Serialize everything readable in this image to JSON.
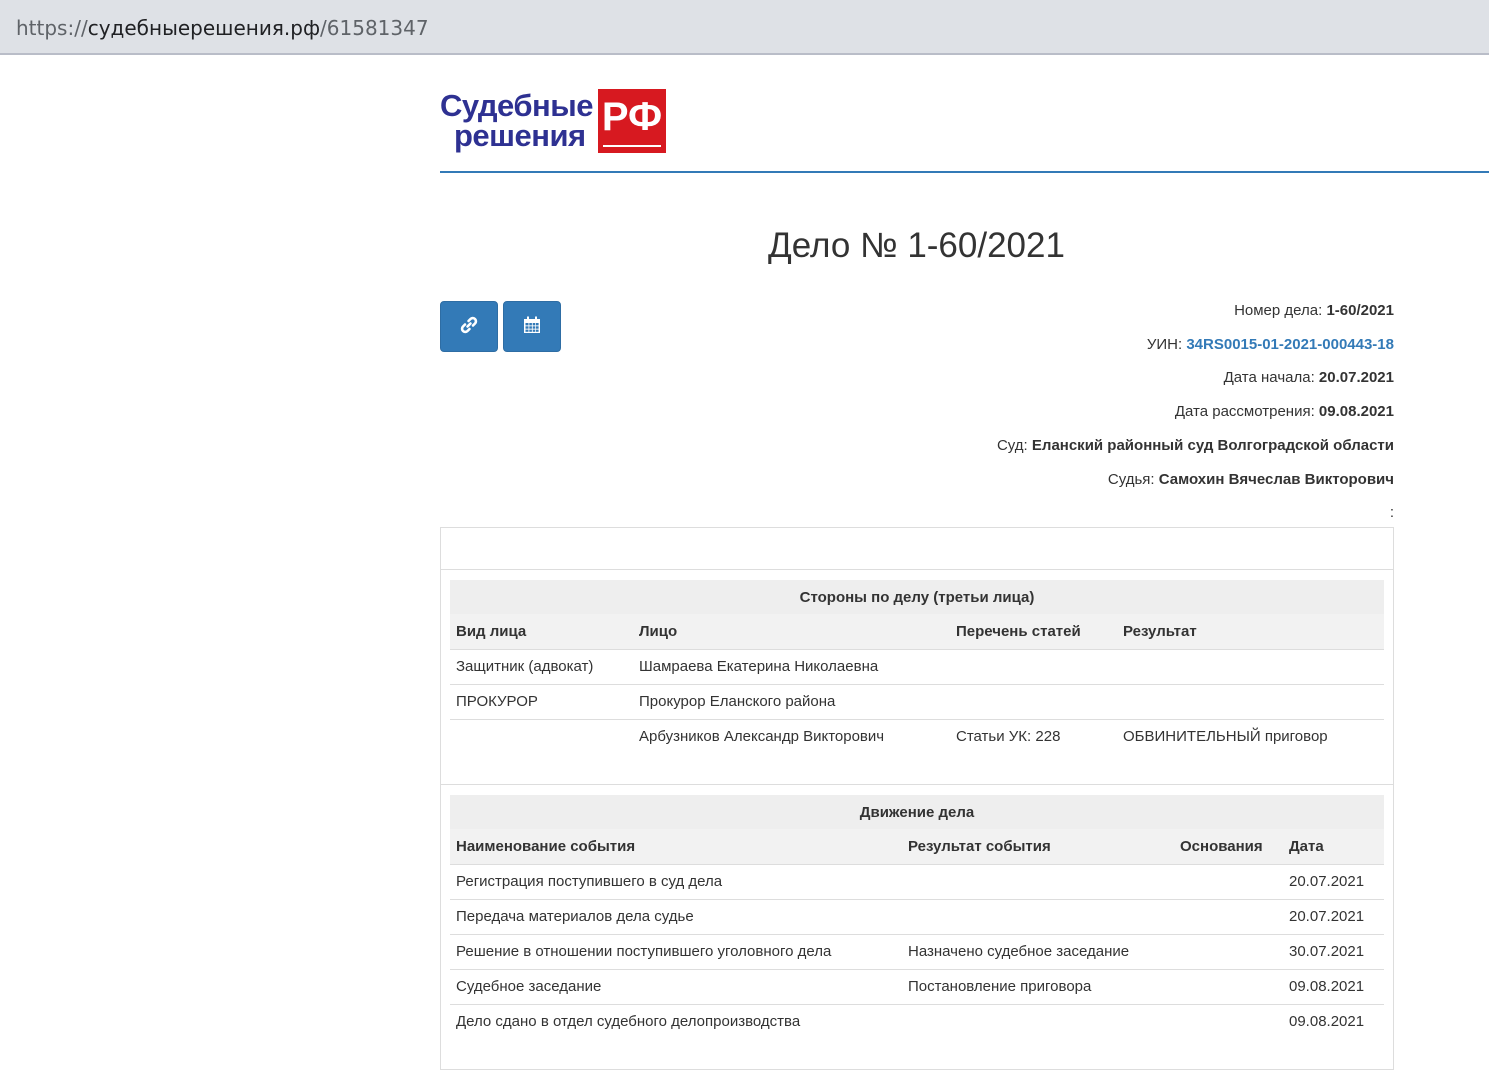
{
  "browser": {
    "url_scheme": "https://",
    "url_host": "судебныерешения.рф",
    "url_path": "/61581347"
  },
  "logo": {
    "line1": "Судебные",
    "line2": "решения",
    "badge": "РФ",
    "colors": {
      "text": "#2e3192",
      "badge": "#d71920"
    }
  },
  "page_title": "Дело № 1-60/2021",
  "toolbar": {
    "link_icon": "link-icon",
    "calendar_icon": "calendar-icon",
    "accent": "#337ab7"
  },
  "case_info": {
    "number_label": "Номер дела:",
    "number_value": "1-60/2021",
    "uin_label": "УИН:",
    "uin_value": "34RS0015-01-2021-000443-18",
    "start_label": "Дата начала:",
    "start_value": "20.07.2021",
    "review_label": "Дата рассмотрения:",
    "review_value": "09.08.2021",
    "court_label": "Суд:",
    "court_value": "Еланский районный суд Волгоградской области",
    "judge_label": "Судья:",
    "judge_value": "Самохин Вячеслав Викторович",
    "extra": ":"
  },
  "parties": {
    "caption": "Стороны по делу (третьи лица)",
    "headers": [
      "Вид лица",
      "Лицо",
      "Перечень статей",
      "Результат"
    ],
    "rows": [
      [
        "Защитник (адвокат)",
        "Шамраева Екатерина Николаевна",
        "",
        ""
      ],
      [
        "ПРОКУРОР",
        "Прокурор Еланского района",
        "",
        ""
      ],
      [
        "",
        "Арбузников Александр Викторович",
        "Статьи УК: 228",
        "ОБВИНИТЕЛЬНЫЙ приговор"
      ]
    ]
  },
  "movement": {
    "caption": "Движение дела",
    "headers": [
      "Наименование события",
      "Результат события",
      "Основания",
      "Дата"
    ],
    "rows": [
      [
        "Регистрация поступившего в суд дела",
        "",
        "",
        "20.07.2021"
      ],
      [
        "Передача материалов дела судье",
        "",
        "",
        "20.07.2021"
      ],
      [
        "Решение в отношении поступившего уголовного дела",
        "Назначено судебное заседание",
        "",
        "30.07.2021"
      ],
      [
        "Судебное заседание",
        "Постановление приговора",
        "",
        "09.08.2021"
      ],
      [
        "Дело сдано в отдел судебного делопроизводства",
        "",
        "",
        "09.08.2021"
      ]
    ]
  }
}
